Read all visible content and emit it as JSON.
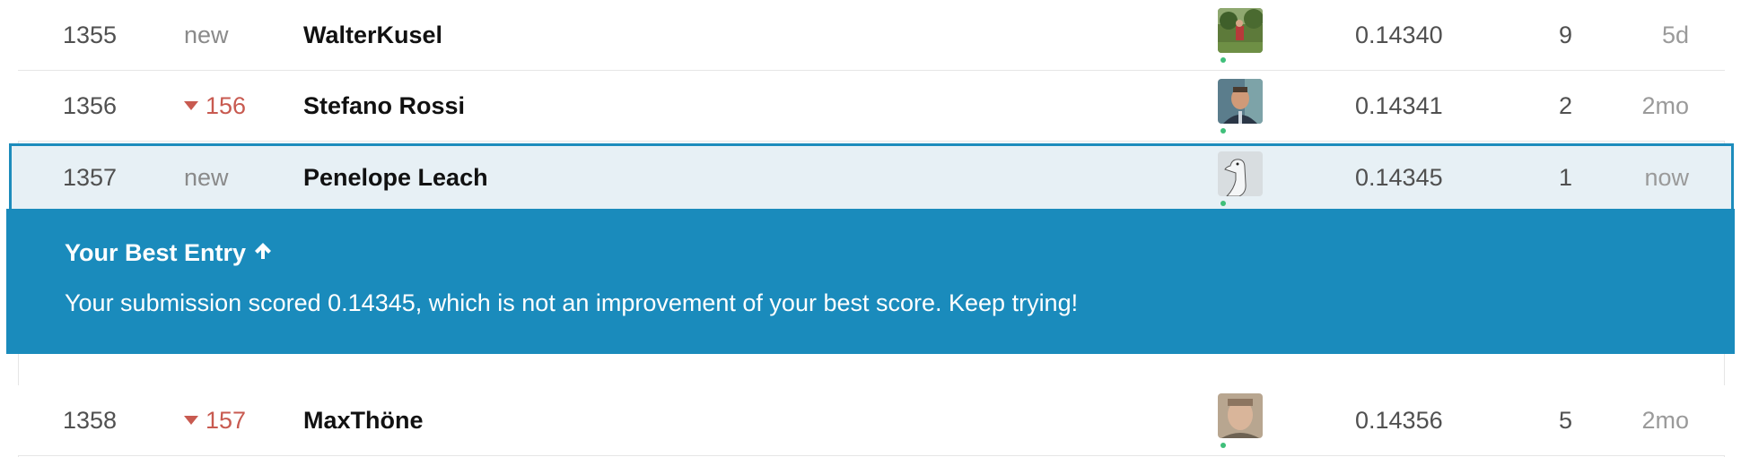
{
  "rows": [
    {
      "rank": "1355",
      "change": "new",
      "change_dir": "new",
      "name": "WalterKusel",
      "avatar_icon": "photo-person-outdoors-icon",
      "score": "0.14340",
      "entries": "9",
      "last": "5d"
    },
    {
      "rank": "1356",
      "change": "156",
      "change_dir": "down",
      "name": "Stefano Rossi",
      "avatar_icon": "photo-person-portrait-icon",
      "score": "0.14341",
      "entries": "2",
      "last": "2mo"
    },
    {
      "rank": "1357",
      "change": "new",
      "change_dir": "new",
      "name": "Penelope Leach",
      "avatar_icon": "goose-sketch-icon",
      "score": "0.14345",
      "entries": "1",
      "last": "now"
    },
    {
      "rank": "1358",
      "change": "157",
      "change_dir": "down",
      "name": "MaxThöne",
      "avatar_icon": "photo-person-face-icon",
      "score": "0.14356",
      "entries": "5",
      "last": "2mo"
    }
  ],
  "banner": {
    "title": "Your Best Entry",
    "title_icon": "arrow-up-icon",
    "message": "Your submission scored 0.14345, which is not an improvement of your best score. Keep trying!"
  },
  "colors": {
    "banner_bg": "#1a8bbc",
    "highlight_border": "#1d8cbc",
    "highlight_bg": "#e7f0f5",
    "rank_down": "#c85a50",
    "online_dot": "#3fbf7a"
  }
}
